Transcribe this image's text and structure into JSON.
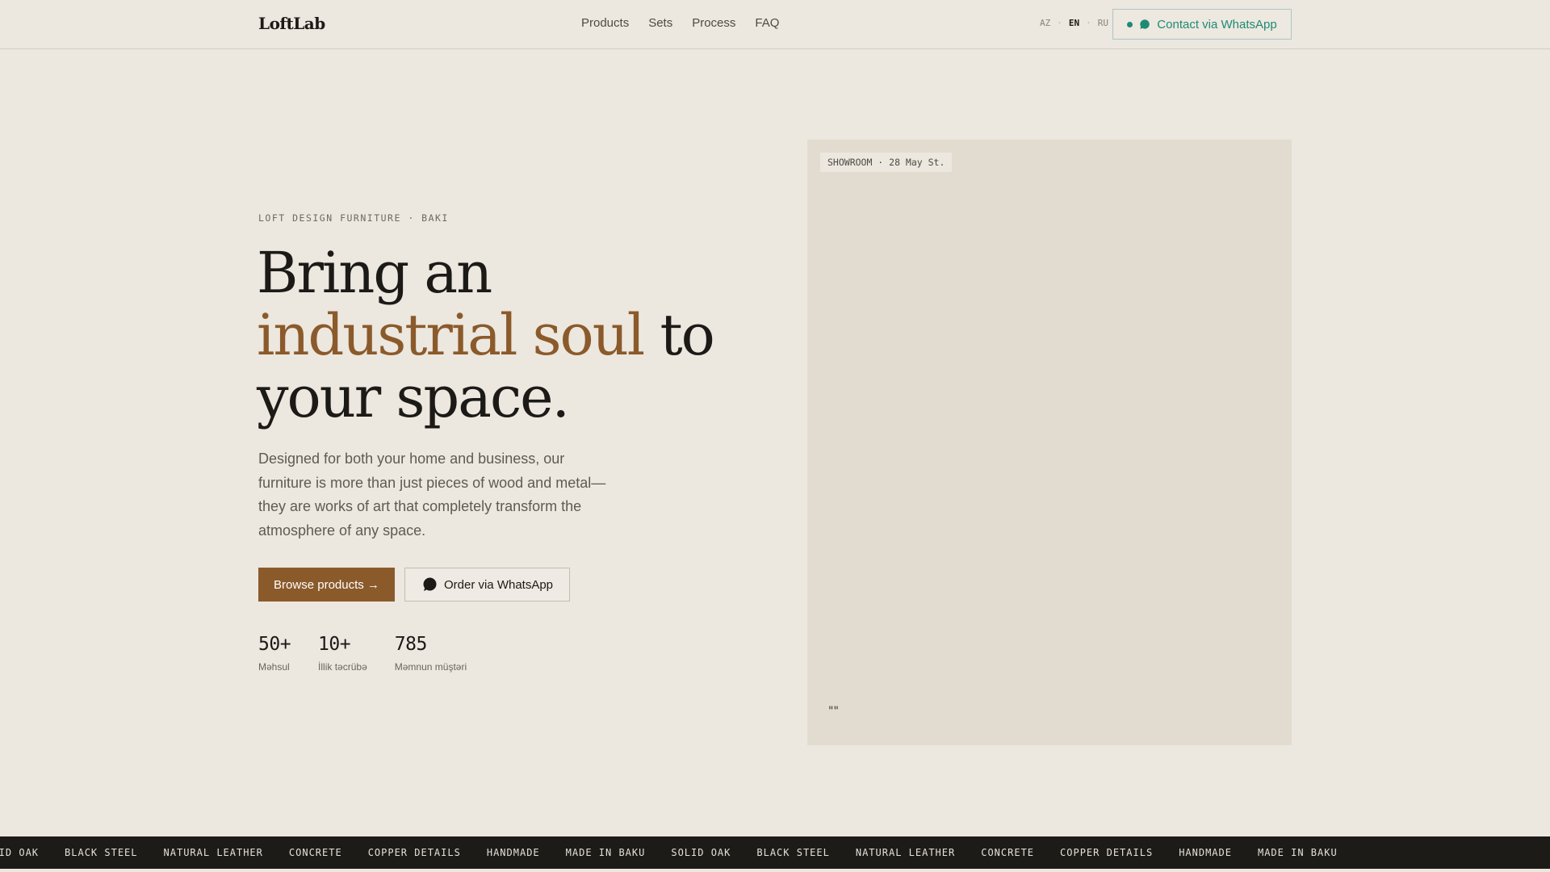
{
  "header": {
    "logo": "LoftLab",
    "nav": [
      "Products",
      "Sets",
      "Process",
      "FAQ"
    ],
    "languages": [
      "AZ",
      "EN",
      "RU"
    ],
    "active_language": "EN",
    "contact_label": "Contact via WhatsApp"
  },
  "hero": {
    "eyebrow": "LOFT DESIGN FURNITURE · BAKI",
    "headline_part1": "Bring an",
    "headline_accent": "industrial soul",
    "headline_part2": "to",
    "headline_part3": "your space.",
    "lead": "Designed for both your home and business, our furniture is more than just pieces of wood and metal—they are works of art that completely transform the atmosphere of any space.",
    "primary_button": "Browse products →",
    "secondary_button": "Order via WhatsApp",
    "stats": [
      {
        "value": "50+",
        "label": "Məhsul"
      },
      {
        "value": "10+",
        "label": "İllik təcrübə"
      },
      {
        "value": "785",
        "label": "Məmnun müştəri"
      }
    ]
  },
  "showcase": {
    "badge": "SHOWROOM · 28 May St.",
    "quote_mark": "\"\""
  },
  "ticker": {
    "items": [
      "SOLID OAK",
      "BLACK STEEL",
      "NATURAL LEATHER",
      "CONCRETE",
      "COPPER DETAILS",
      "HANDMADE",
      "MADE IN BAKU",
      "SOLID OAK",
      "BLACK STEEL",
      "NATURAL LEATHER",
      "CONCRETE",
      "COPPER DETAILS",
      "HANDMADE",
      "MADE IN BAKU"
    ]
  },
  "colors": {
    "background": "#ece7df",
    "accent": "#8b5a2b",
    "whatsapp": "#1f8a74",
    "ticker_bg": "#1d1b18"
  }
}
